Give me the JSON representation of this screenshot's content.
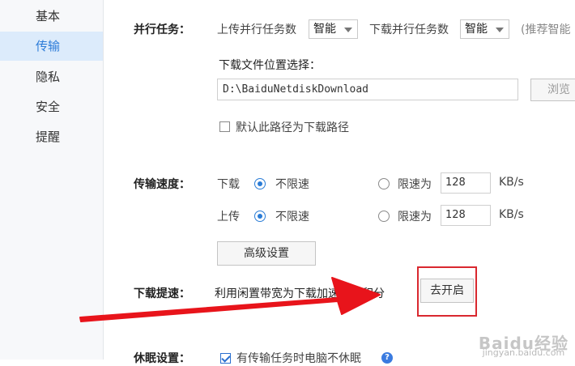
{
  "sidebar": {
    "items": [
      {
        "label": "基本"
      },
      {
        "label": "传输"
      },
      {
        "label": "隐私"
      },
      {
        "label": "安全"
      },
      {
        "label": "提醒"
      }
    ],
    "active": "传输"
  },
  "parallel": {
    "label": "并行任务：",
    "upload_label": "上传并行任务数",
    "upload_value": "智能",
    "download_label": "下载并行任务数",
    "download_value": "智能",
    "recommend_text": "(推荐智能"
  },
  "download_location": {
    "title": "下载文件位置选择：",
    "path": "D:\\BaiduNetdiskDownload",
    "browse_label": "浏览",
    "default_checkbox_label": "默认此路径为下载路径",
    "default_checked": false
  },
  "speed": {
    "label": "传输速度：",
    "download_label": "下载",
    "upload_label": "上传",
    "unlimited_label": "不限速",
    "limit_label": "限速为",
    "download_limit_value": "128",
    "upload_limit_value": "128",
    "unit": "KB/s",
    "download_mode": "unlimited",
    "upload_mode": "unlimited",
    "advanced_label": "高级设置"
  },
  "boost": {
    "label": "下载提速：",
    "description": "利用闲置带宽为下载加速换取积分",
    "enable_label": "去开启"
  },
  "sleep": {
    "label": "休眠设置：",
    "checkbox_label": "有传输任务时电脑不休眠",
    "checked": true
  },
  "watermark": {
    "brand": "Baidu经验",
    "url": "jingyan.baidu.com"
  },
  "colors": {
    "accent": "#2b7bd8",
    "annotation_red": "#e8141b"
  }
}
